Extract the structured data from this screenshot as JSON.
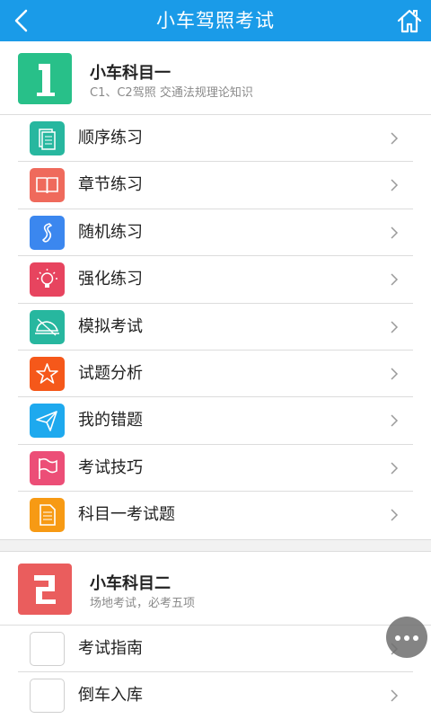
{
  "header": {
    "title": "小车驾照考试",
    "bg_color": "#1a9be8",
    "back_icon": "back-chevron-icon",
    "home_icon": "home-icon"
  },
  "section1": {
    "badge_glyph": "1",
    "badge_color": "#28c089",
    "title": "小车科目一",
    "subtitle": "C1、C2驾照 交通法规理论知识",
    "items": [
      {
        "label": "顺序练习",
        "icon": "document-stack-icon",
        "color": "#27b79f"
      },
      {
        "label": "章节练习",
        "icon": "open-book-icon",
        "color": "#ef6a5c"
      },
      {
        "label": "随机练习",
        "icon": "shuffle-icon",
        "color": "#3b87ef"
      },
      {
        "label": "强化练习",
        "icon": "light-bulb-icon",
        "color": "#e7445f"
      },
      {
        "label": "模拟考试",
        "icon": "hat-icon",
        "color": "#27b79f"
      },
      {
        "label": "试题分析",
        "icon": "star-icon",
        "color": "#f5581a"
      },
      {
        "label": "我的错题",
        "icon": "paper-plane-icon",
        "color": "#1ea9ee"
      },
      {
        "label": "考试技巧",
        "icon": "flag-icon",
        "color": "#ec4e77"
      },
      {
        "label": "科目一考试题",
        "icon": "document-icon",
        "color": "#f79a14"
      }
    ]
  },
  "section2": {
    "badge_glyph": "2",
    "badge_color": "#ea5d5d",
    "title": "小车科目二",
    "subtitle": "场地考试，必考五项",
    "items": [
      {
        "label": "考试指南",
        "icon": "blank-icon"
      },
      {
        "label": "倒车入库",
        "icon": "blank-icon"
      }
    ]
  },
  "fab": {
    "icon": "more-dots-icon"
  }
}
